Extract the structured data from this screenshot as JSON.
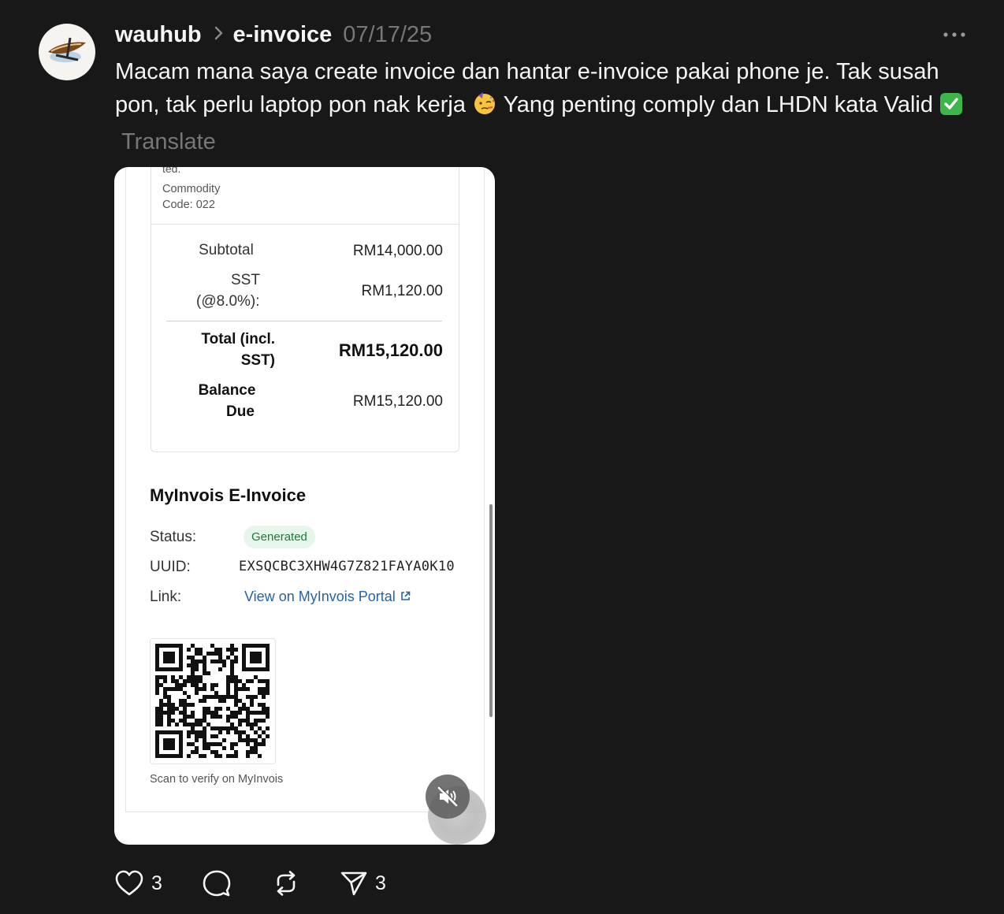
{
  "post": {
    "username": "wauhub",
    "topic": "e-invoice",
    "date": "07/17/25",
    "text_part1": "Macam mana saya create invoice dan hantar e-invoice pakai phone je. Tak susah pon, tak perlu laptop pon nak kerja ",
    "text_part2": " Yang penting comply dan LHDN kata Valid ",
    "translate_label": "Translate"
  },
  "invoice": {
    "cut_text": "ted.",
    "commodity_label": "Commodity",
    "commodity_code": "Code: 022",
    "subtotal_label": "Subtotal",
    "subtotal_value": "RM14,000.00",
    "sst_label_line1": "SST",
    "sst_label_line2": "(@8.0%):",
    "sst_value": "RM1,120.00",
    "total_label_line1": "Total (incl.",
    "total_label_line2": "SST)",
    "total_value": "RM15,120.00",
    "balance_label_line1": "Balance",
    "balance_label_line2": "Due",
    "balance_value": "RM15,120.00"
  },
  "myinvois": {
    "title": "MyInvois E-Invoice",
    "status_label": "Status:",
    "status_value": "Generated",
    "uuid_label": "UUID:",
    "uuid_value": "EXSQCBC3XHW4G7Z821FAYA0K10",
    "link_label": "Link:",
    "link_text": "View on MyInvois Portal",
    "scan_text": "Scan to verify on MyInvois"
  },
  "actions": {
    "like_count": "3",
    "share_count": "3"
  },
  "colors": {
    "background": "#181818",
    "badge_bg": "#e6f6ea",
    "badge_text": "#1d7a36",
    "link": "#2563a6"
  }
}
